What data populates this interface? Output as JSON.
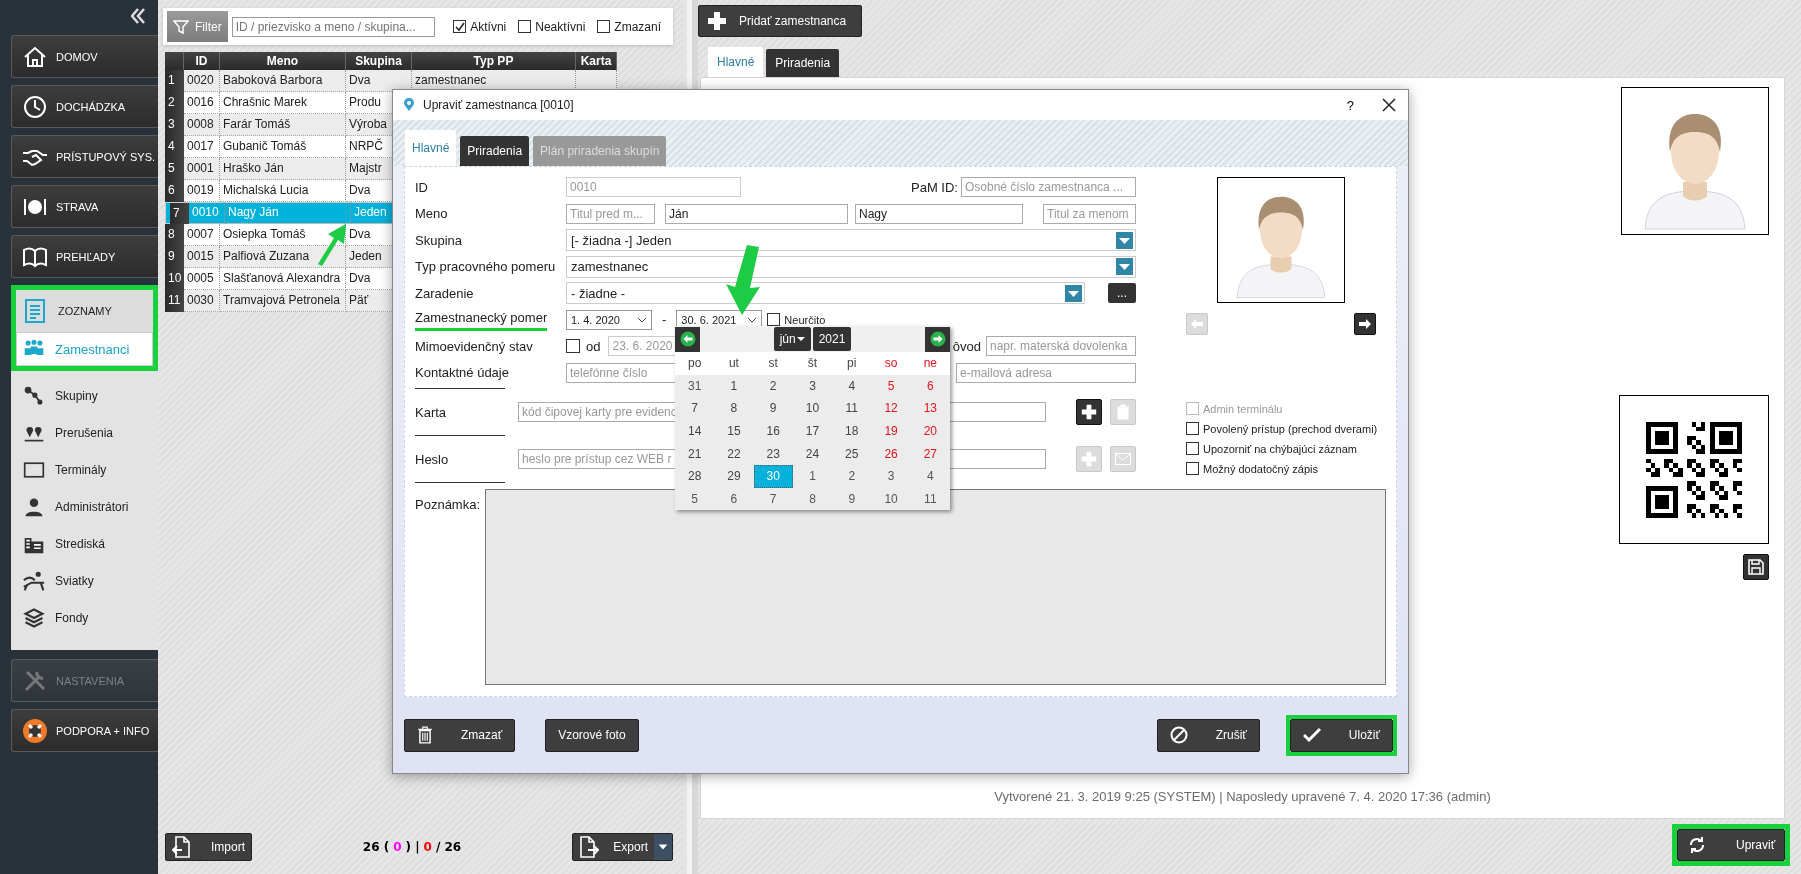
{
  "sidebar": {
    "nav": [
      {
        "label": "DOMOV",
        "disabled": false,
        "expanded": false
      },
      {
        "label": "DOCHÁDZKA",
        "disabled": false,
        "expanded": false
      },
      {
        "label": "PRÍSTUPOVÝ SYS.",
        "disabled": false,
        "expanded": false
      },
      {
        "label": "STRAVA",
        "disabled": false,
        "expanded": false
      },
      {
        "label": "PREHĽADY",
        "disabled": false,
        "expanded": false
      },
      {
        "label": "ZOZNAMY",
        "disabled": false,
        "expanded": true,
        "children": [
          {
            "label": "Zamestnanci",
            "selected": true
          },
          {
            "label": "Skupiny",
            "selected": false
          },
          {
            "label": "Prerušenia",
            "selected": false
          },
          {
            "label": "Terminály",
            "selected": false
          },
          {
            "label": "Administrátori",
            "selected": false
          },
          {
            "label": "Strediská",
            "selected": false
          },
          {
            "label": "Sviatky",
            "selected": false
          },
          {
            "label": "Fondy",
            "selected": false
          }
        ]
      },
      {
        "label": "NASTAVENIA",
        "disabled": true,
        "expanded": false
      },
      {
        "label": "PODPORA + INFO",
        "disabled": false,
        "expanded": false
      }
    ]
  },
  "filter": {
    "button": "Filter",
    "placeholder": "ID / priezvisko a meno / skupina...",
    "options": [
      {
        "label": "Aktívni",
        "checked": true
      },
      {
        "label": "Neaktívni",
        "checked": false
      },
      {
        "label": "Zmazaní",
        "checked": false
      }
    ]
  },
  "table": {
    "columns": [
      "ID",
      "Meno",
      "Skupina",
      "Typ PP",
      "Karta"
    ],
    "rows": [
      {
        "num": "1",
        "selected": false,
        "cells": [
          "0020",
          "Baboková Barbora",
          "Dva",
          "zamestnanec"
        ]
      },
      {
        "num": "2",
        "selected": false,
        "cells": [
          "0016",
          "Chrašnic Marek",
          "Produ"
        ]
      },
      {
        "num": "3",
        "selected": false,
        "cells": [
          "0008",
          "Farár Tomáš",
          "Výroba"
        ]
      },
      {
        "num": "4",
        "selected": false,
        "cells": [
          "0017",
          "Gubanič Tomáš",
          "NRPČ"
        ]
      },
      {
        "num": "5",
        "selected": false,
        "cells": [
          "0001",
          "Hraško Ján",
          "Majstr"
        ]
      },
      {
        "num": "6",
        "selected": false,
        "cells": [
          "0019",
          "Michalská Lucia",
          "Dva"
        ]
      },
      {
        "num": "7",
        "selected": true,
        "cells": [
          "0010",
          "Nagy Ján",
          "Jeden"
        ]
      },
      {
        "num": "8",
        "selected": false,
        "cells": [
          "0007",
          "Osiepka Tomáš",
          "Dva"
        ]
      },
      {
        "num": "9",
        "selected": false,
        "cells": [
          "0015",
          "Palfiová Zuzana",
          "Jeden"
        ]
      },
      {
        "num": "10",
        "selected": false,
        "cells": [
          "0005",
          "Slašťanová Alexandra",
          "Dva"
        ]
      },
      {
        "num": "11",
        "selected": false,
        "cells": [
          "0030",
          "Tramvajová Petronela",
          "Päť"
        ]
      }
    ]
  },
  "list_footer": {
    "import": "Import",
    "export": "Export",
    "counts": [
      {
        "text": "26 (",
        "color": "#000000"
      },
      {
        "text": "0",
        "color": "#ff00ff"
      },
      {
        "text": ") |",
        "color": "#000000"
      },
      {
        "text": "0",
        "color": "#ff0000"
      },
      {
        "text": "/ 26",
        "color": "#000000"
      }
    ]
  },
  "detail": {
    "add_button": "Pridať zamestnanca",
    "tabs": [
      {
        "label": "Hlavné",
        "selected": true
      },
      {
        "label": "Priradenia",
        "selected": false
      }
    ],
    "footer": "Vytvorené 21. 3. 2019 9:25 (SYSTEM) | Naposledy upravené 7. 4. 2020 17:36 (admin)",
    "edit_button": "Upraviť"
  },
  "dialog": {
    "title": "Upraviť zamestnanca [0010]",
    "help": "?",
    "tabs": [
      {
        "label": "Hlavné",
        "selected": true,
        "disabled": false
      },
      {
        "label": "Priradenia",
        "selected": false,
        "disabled": false
      },
      {
        "label": "Plán priradenia skupín",
        "selected": false,
        "disabled": true
      }
    ],
    "id": {
      "label": "ID",
      "value": "0010"
    },
    "pam_id": {
      "label": "PaM ID:",
      "placeholder": "Osobné číslo zamestnanca ..."
    },
    "name": {
      "label": "Meno",
      "title_before_placeholder": "Titul pred m...",
      "first": "Ján",
      "last": "Nagy",
      "title_after_placeholder": "Titul za menom"
    },
    "group": {
      "label": "Skupina",
      "value": "[- žiadna -] Jeden"
    },
    "employment_type": {
      "label": "Typ pracovného pomeru",
      "value": "zamestnanec"
    },
    "assignment": {
      "label": "Zaradenie",
      "value": "- žiadne -",
      "more": "..."
    },
    "employment": {
      "label": "Zamestnanecký pomer",
      "from": "1. 4. 2020",
      "separator": "-",
      "to": "30. 6. 2021",
      "indefinite": {
        "label": "Neurčito",
        "checked": false
      }
    },
    "off_record": {
      "label": "Mimoevidenčný stav",
      "checked": false,
      "from_label": "od",
      "from": "23. 6. 2020",
      "reason_label": "ôvod",
      "reason_placeholder": "napr. materská dovolenka"
    },
    "contact": {
      "label": "Kontaktné údaje",
      "phone_placeholder": "telefónne číslo",
      "email_placeholder": "e-mailová adresa"
    },
    "card": {
      "label": "Karta",
      "placeholder": "kód čipovej karty pre evidenc",
      "add_disabled": false,
      "delete_disabled": true
    },
    "password": {
      "label": "Heslo",
      "placeholder": "heslo pre prístup cez WEB r",
      "add_disabled": true,
      "mail_disabled": true
    },
    "note": {
      "label": "Poznámka:"
    },
    "photo": {
      "prev_disabled": true,
      "next_disabled": false
    },
    "flags": [
      {
        "label": "Admin terminálu",
        "checked": false,
        "disabled": true
      },
      {
        "label": "Povolený prístup (prechod dverami)",
        "checked": false,
        "disabled": false
      },
      {
        "label": "Upozorniť na chýbajúci záznam",
        "checked": false,
        "disabled": false
      },
      {
        "label": "Možný dodatočný zápis",
        "checked": false,
        "disabled": false
      }
    ],
    "calendar": {
      "month": "jún",
      "year": "2021",
      "weekdays": [
        {
          "label": "po",
          "weekend": false
        },
        {
          "label": "ut",
          "weekend": false
        },
        {
          "label": "st",
          "weekend": false
        },
        {
          "label": "št",
          "weekend": false
        },
        {
          "label": "pi",
          "weekend": false
        },
        {
          "label": "so",
          "weekend": true
        },
        {
          "label": "ne",
          "weekend": true
        }
      ],
      "weeks": [
        [
          {
            "day": "31",
            "other_month": true,
            "selected": false
          },
          {
            "day": "1",
            "other_month": false,
            "selected": false
          },
          {
            "day": "2",
            "other_month": false,
            "selected": false
          },
          {
            "day": "3",
            "other_month": false,
            "selected": false
          },
          {
            "day": "4",
            "other_month": false,
            "selected": false
          },
          {
            "day": "5",
            "other_month": false,
            "selected": false
          },
          {
            "day": "6",
            "other_month": false,
            "selected": false
          }
        ],
        [
          {
            "day": "7",
            "other_month": false,
            "selected": false
          },
          {
            "day": "8",
            "other_month": false,
            "selected": false
          },
          {
            "day": "9",
            "other_month": false,
            "selected": false
          },
          {
            "day": "10",
            "other_month": false,
            "selected": false
          },
          {
            "day": "11",
            "other_month": false,
            "selected": false
          },
          {
            "day": "12",
            "other_month": false,
            "selected": false
          },
          {
            "day": "13",
            "other_month": false,
            "selected": false
          }
        ],
        [
          {
            "day": "14",
            "other_month": false,
            "selected": false
          },
          {
            "day": "15",
            "other_month": false,
            "selected": false
          },
          {
            "day": "16",
            "other_month": false,
            "selected": false
          },
          {
            "day": "17",
            "other_month": false,
            "selected": false
          },
          {
            "day": "18",
            "other_month": false,
            "selected": false
          },
          {
            "day": "19",
            "other_month": false,
            "selected": false
          },
          {
            "day": "20",
            "other_month": false,
            "selected": false
          }
        ],
        [
          {
            "day": "21",
            "other_month": false,
            "selected": false
          },
          {
            "day": "22",
            "other_month": false,
            "selected": false
          },
          {
            "day": "23",
            "other_month": false,
            "selected": false
          },
          {
            "day": "24",
            "other_month": false,
            "selected": false
          },
          {
            "day": "25",
            "other_month": false,
            "selected": false
          },
          {
            "day": "26",
            "other_month": false,
            "selected": false
          },
          {
            "day": "27",
            "other_month": false,
            "selected": false
          }
        ],
        [
          {
            "day": "28",
            "other_month": false,
            "selected": false
          },
          {
            "day": "29",
            "other_month": false,
            "selected": false
          },
          {
            "day": "30",
            "other_month": false,
            "selected": true
          },
          {
            "day": "1",
            "other_month": true,
            "selected": false
          },
          {
            "day": "2",
            "other_month": true,
            "selected": false
          },
          {
            "day": "3",
            "other_month": true,
            "selected": false
          },
          {
            "day": "4",
            "other_month": true,
            "selected": false
          }
        ],
        [
          {
            "day": "5",
            "other_month": true,
            "selected": false
          },
          {
            "day": "6",
            "other_month": true,
            "selected": false
          },
          {
            "day": "7",
            "other_month": true,
            "selected": false
          },
          {
            "day": "8",
            "other_month": true,
            "selected": false
          },
          {
            "day": "9",
            "other_month": true,
            "selected": false
          },
          {
            "day": "10",
            "other_month": true,
            "selected": false
          },
          {
            "day": "11",
            "other_month": true,
            "selected": false
          }
        ]
      ]
    },
    "buttons": {
      "delete": "Zmazať",
      "sample_photo": "Vzorové foto",
      "cancel": "Zrušiť",
      "save": "Uložiť"
    }
  }
}
